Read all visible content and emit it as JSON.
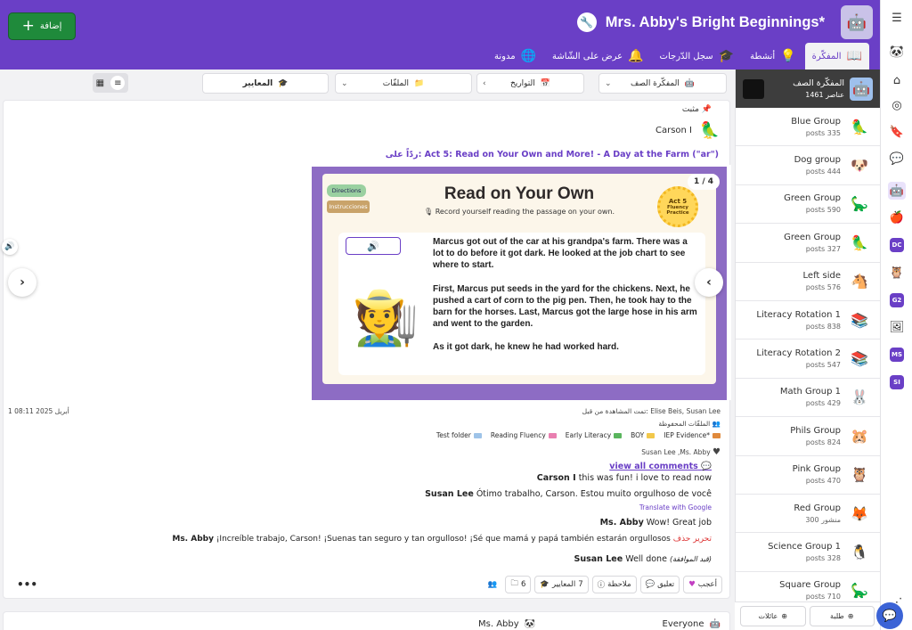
{
  "header": {
    "class_title": "Mrs. Abby's Bright Beginnings*",
    "add_label": "إضافة",
    "nav_tabs": [
      {
        "label": "المفكّرة",
        "icon": "journal-icon",
        "active": true
      },
      {
        "label": "أنشطة",
        "icon": "lightbulb-icon",
        "active": false
      },
      {
        "label": "سجل الدّرجات",
        "icon": "graduation-cap-icon",
        "active": false
      },
      {
        "label": "عرض على الشّاشة",
        "icon": "bell-icon",
        "active": false
      },
      {
        "label": "مدونة",
        "icon": "globe-icon",
        "active": false
      }
    ]
  },
  "filters": {
    "journal": "المفكّرة الصف",
    "dates": "التواريخ",
    "files": "الملفّات",
    "standards": "المعايير"
  },
  "sidebar": {
    "header": {
      "name": "المفكّرة الصف",
      "count": "1461 عناصر"
    },
    "groups": [
      {
        "name": "Blue Group",
        "count": "posts 335",
        "avatar": "🦜"
      },
      {
        "name": "Dog group",
        "count": "posts 444",
        "avatar": "🐶"
      },
      {
        "name": "Green Group",
        "count": "posts 590",
        "avatar": "🦕"
      },
      {
        "name": "Green Group",
        "count": "posts 327",
        "avatar": "🦜"
      },
      {
        "name": "Left side",
        "count": "posts 576",
        "avatar": "🐴"
      },
      {
        "name": "Literacy Rotation 1",
        "count": "posts 838",
        "avatar": "📚"
      },
      {
        "name": "Literacy Rotation 2",
        "count": "posts 547",
        "avatar": "📚"
      },
      {
        "name": "Math Group 1",
        "count": "posts 429",
        "avatar": "🐰"
      },
      {
        "name": "Phils Group",
        "count": "posts 824",
        "avatar": "🐹"
      },
      {
        "name": "Pink Group",
        "count": "posts 470",
        "avatar": "🦉"
      },
      {
        "name": "Red Group",
        "count": "300 منشور",
        "avatar": "🦊"
      },
      {
        "name": "Science Group 1",
        "count": "posts 328",
        "avatar": "🐧"
      },
      {
        "name": "Square Group",
        "count": "posts 710",
        "avatar": "🦕"
      }
    ],
    "footer": {
      "students": "طلبة",
      "families": "عائلات"
    }
  },
  "rail": {
    "badges": [
      "DC",
      "G2",
      "MS",
      "SI"
    ]
  },
  "post": {
    "pinned": "مثبت",
    "author": "Carson I",
    "reply_to": "ردّاً على: Act 5: Read on Your Own and More! - A Day at the Farm (\"ar\")",
    "slide": {
      "page": "1 / 4",
      "title": "Read on Your Own",
      "subtitle": "Record yourself reading the passage on your own.",
      "directions": "Directions",
      "instrucciones": "Instrucciones",
      "badge_line1": "Act 5",
      "badge_line2": "Fluency",
      "badge_line3": "Practice",
      "story": [
        "Marcus got out of the car at his grandpa's farm. There was a lot to do before it got dark. He looked at the job chart to see where to start.",
        "First, Marcus put seeds in the yard for the chickens. Next, he pushed a cart of corn to the pig pen. Then, he took hay to the barn for the horses. Last, Marcus got the large hose in his arm and went to the garden.",
        "As it got dark, he knew he had worked hard."
      ]
    },
    "date": "1 أبريل 2025 08:11",
    "seen_by": "تمت المشاهدة من قبل: Elise Beis, Susan Lee",
    "saved_files": "الملفّات المحفوظة",
    "tags": [
      {
        "label": "IEP Evidence*",
        "color": "#e08a3c"
      },
      {
        "label": "BOY",
        "color": "#f2c84b"
      },
      {
        "label": "Early Literacy",
        "color": "#5ab55e"
      },
      {
        "label": "Reading Fluency",
        "color": "#e97fb0"
      },
      {
        "label": "Test folder",
        "color": "#9ec3e8"
      }
    ],
    "likes": "Susan Lee ,Ms. Abby",
    "view_all_comments": "view all comments",
    "comments": [
      {
        "author": "Carson I",
        "text": "this was fun! i love to read now"
      },
      {
        "author": "Susan Lee",
        "text": "Ótimo trabalho, Carson. Estou muito orgulhoso de você"
      },
      {
        "author": "Ms. Abby",
        "text": "Wow! Great job"
      },
      {
        "author": "Ms. Abby",
        "text": "¡Increíble trabajo, Carson! ¡Suenas tan seguro y tan orgulloso! ¡Sé que mamá y papá también estarán orgullosos"
      },
      {
        "author": "Susan Lee",
        "text": "Well done"
      }
    ],
    "translate": "Translate with Google",
    "edit": "تحرير",
    "delete": "حذف",
    "pending": "(قيد الموافقة)",
    "actions": {
      "like": "أعجب",
      "comment": "تعليق",
      "note": "ملاحظة",
      "standards": "المعايير",
      "standards_count": "7",
      "folders_count": "6"
    }
  },
  "next_post": {
    "author": "Ms. Abby",
    "audience": "Everyone"
  }
}
